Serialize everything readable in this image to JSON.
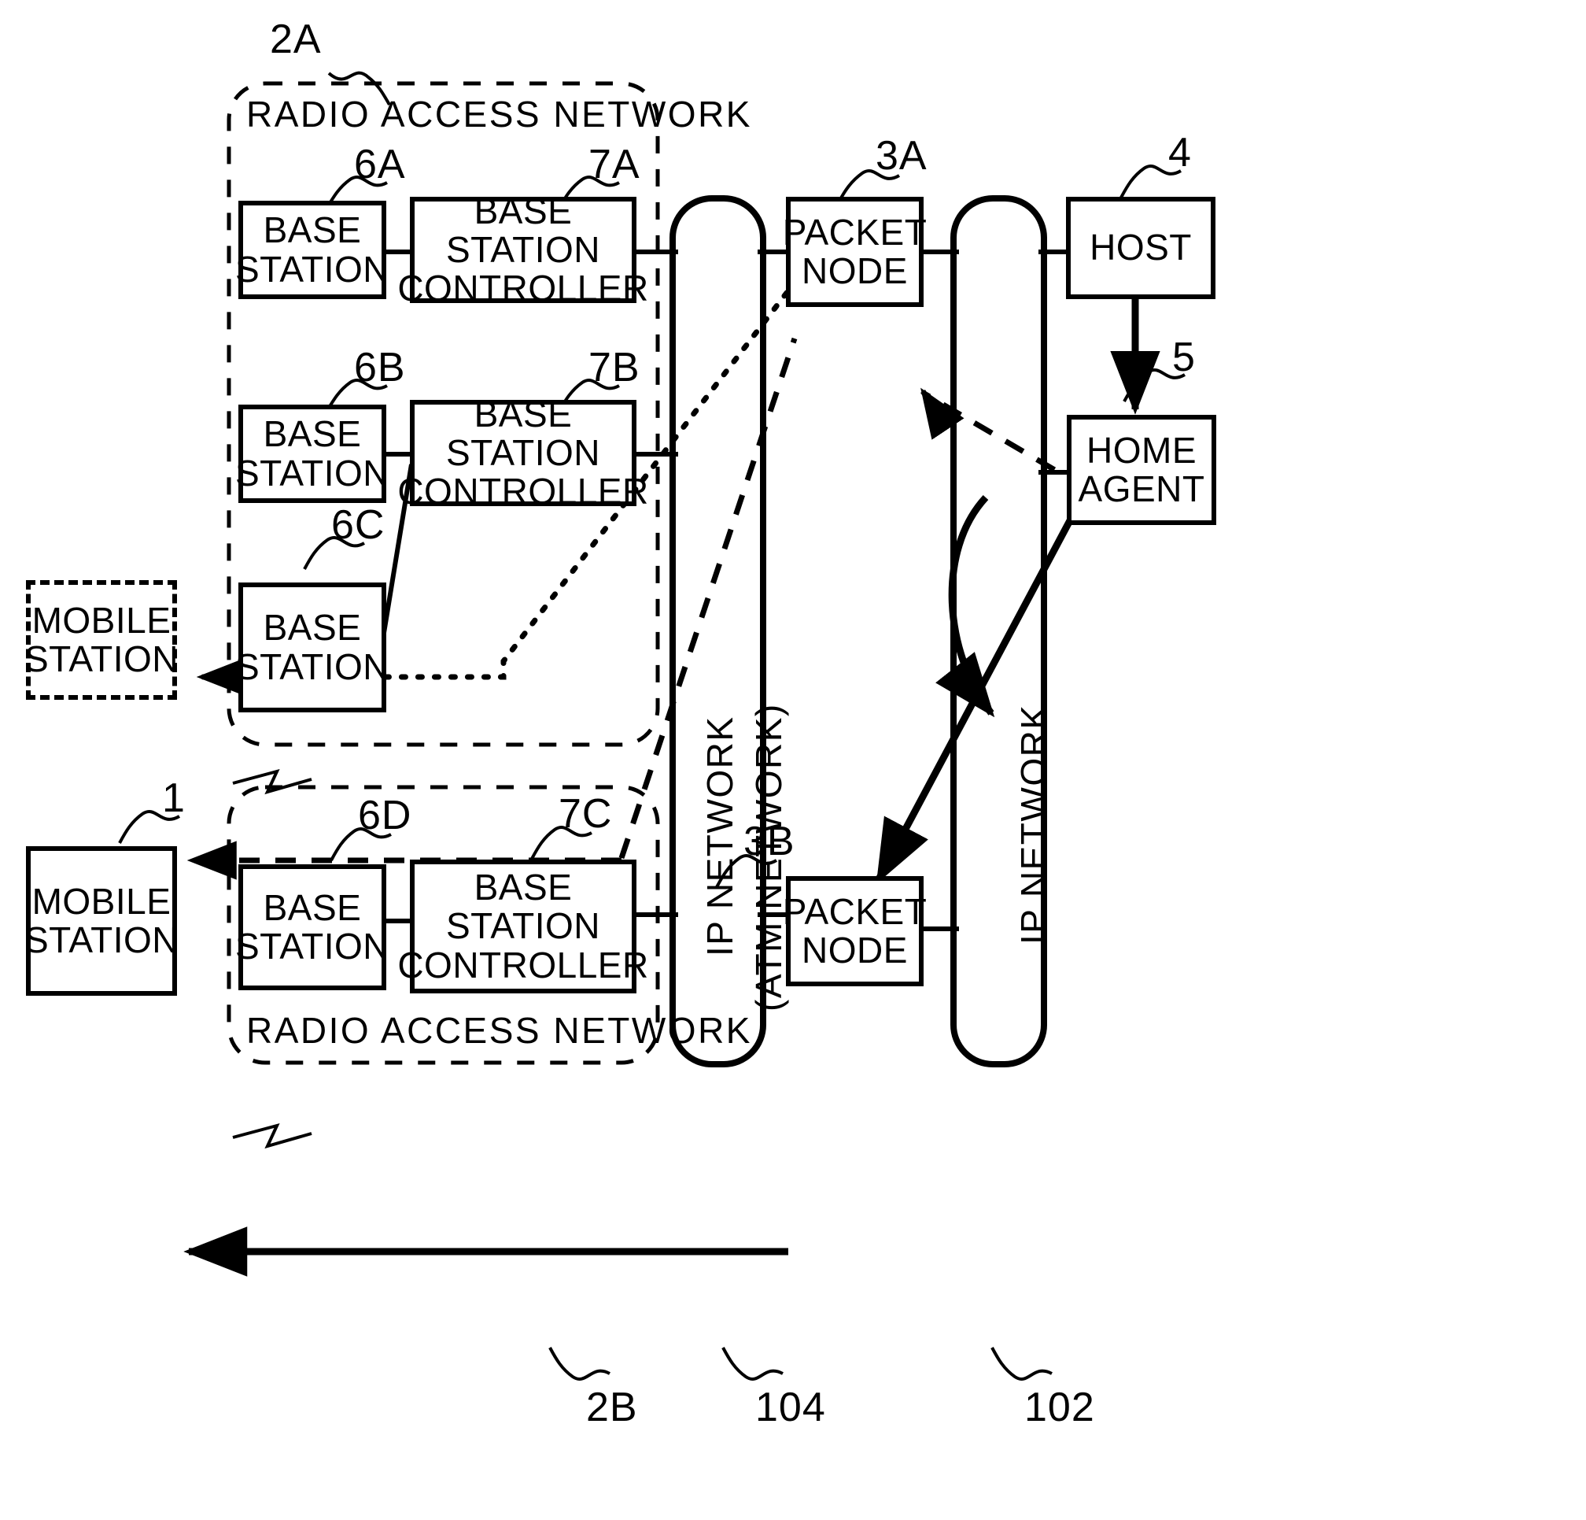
{
  "figure": {
    "type": "patent-block-diagram",
    "background": "#ffffff",
    "line_color": "#000000"
  },
  "zones": [
    {
      "id": "ran_upper",
      "title": "RADIO  ACCESS  NETWORK",
      "ref": "2A"
    },
    {
      "id": "ran_lower",
      "title": "RADIO  ACCESS  NETWORK",
      "ref": "2B"
    }
  ],
  "nodes": {
    "mobile_station_dashed": {
      "line1": "MOBILE",
      "line2": "STATION",
      "style": "dashed"
    },
    "mobile_station_solid": {
      "line1": "MOBILE",
      "line2": "STATION",
      "style": "solid",
      "ref": "1"
    },
    "base_station_6a": {
      "line1": "BASE",
      "line2": "STATION",
      "ref": "6A"
    },
    "base_station_6b": {
      "line1": "BASE",
      "line2": "STATION",
      "ref": "6B"
    },
    "base_station_6c": {
      "line1": "BASE",
      "line2": "STATION",
      "ref": "6C"
    },
    "base_station_6d": {
      "line1": "BASE",
      "line2": "STATION",
      "ref": "6D"
    },
    "bsc_7a": {
      "line1": "BASE",
      "line2": "STATION",
      "line3": "CONTROLLER",
      "ref": "7A"
    },
    "bsc_7b": {
      "line1": "BASE",
      "line2": "STATION",
      "line3": "CONTROLLER",
      "ref": "7B"
    },
    "bsc_7c": {
      "line1": "BASE",
      "line2": "STATION",
      "line3": "CONTROLLER",
      "ref": "7C"
    },
    "packet_node_3a": {
      "line1": "PACKET",
      "line2": "NODE",
      "ref": "3A"
    },
    "packet_node_3b": {
      "line1": "PACKET",
      "line2": "NODE",
      "ref": "3B"
    },
    "host_4": {
      "line1": "HOST",
      "ref": "4"
    },
    "home_agent_5": {
      "line1": "HOME",
      "line2": "AGENT",
      "ref": "5"
    }
  },
  "networks": {
    "ip_atm_network": {
      "label_line1": "IP NETWORK",
      "label_line2": "(ATM NETWORK)",
      "ref": "104"
    },
    "ip_network": {
      "label_line1": "IP NETWORK",
      "ref": "102"
    }
  },
  "reference_numerals": [
    "2A",
    "6A",
    "7A",
    "3A",
    "4",
    "6B",
    "7B",
    "5",
    "6C",
    "1",
    "6D",
    "7C",
    "3B",
    "2B",
    "104",
    "102"
  ]
}
